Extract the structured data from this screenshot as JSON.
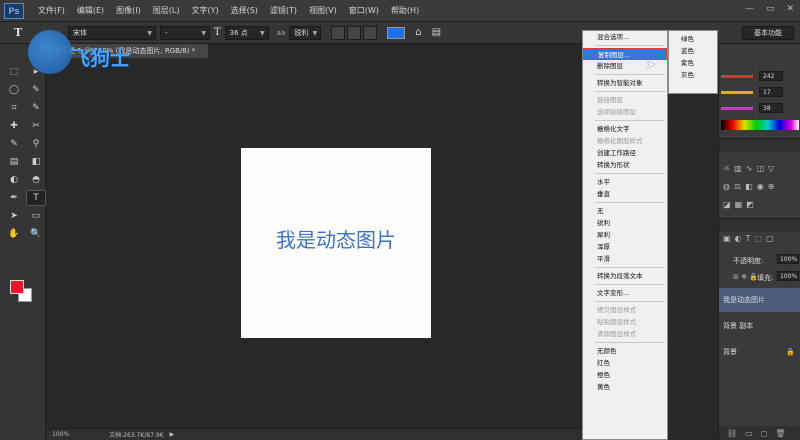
{
  "app": {
    "logo": "Ps"
  },
  "menu": [
    "文件(F)",
    "编辑(E)",
    "图像(I)",
    "图层(L)",
    "文字(Y)",
    "选择(S)",
    "滤镜(T)",
    "视图(V)",
    "窗口(W)",
    "帮助(H)"
  ],
  "window_controls": [
    "—",
    "▭",
    "✕"
  ],
  "options": {
    "tool_glyph": "T",
    "font_family": "宋体",
    "font_style": "-",
    "font_size": "36 点",
    "antialias": "锐利",
    "text_color": "#1e6fe8",
    "workspace": "基本功能"
  },
  "document": {
    "tab_title": "未标题-1 @ 100% (我是动态图片, RGB/8) *",
    "canvas_text": "我是动态图片",
    "zoom": "100%",
    "doc_info": "文档:263.7K/87.9K"
  },
  "watermark": {
    "text": "飞狗士"
  },
  "toolbar": {
    "tools": [
      "⬚",
      "▸",
      "◯",
      "✎",
      "⌗",
      "✎",
      "✚",
      "✂",
      "✎",
      "⚲",
      "▤",
      "◧",
      "◐",
      "◓",
      "✒",
      "T",
      "➤",
      "▭",
      "✋",
      "🔍"
    ],
    "foreground_color": "#e8192c",
    "background_color": "#ffffff"
  },
  "context_menu": {
    "groups": [
      [
        {
          "label": "混合选项...",
          "disabled": false
        }
      ],
      [
        {
          "label": "复制图层...",
          "disabled": false,
          "highlighted": true
        },
        {
          "label": "删除图层",
          "disabled": false
        }
      ],
      [
        {
          "label": "转换为智能对象",
          "disabled": false
        }
      ],
      [
        {
          "label": "链接图层",
          "disabled": true
        },
        {
          "label": "选择链接图层",
          "disabled": true
        }
      ],
      [
        {
          "label": "栅格化文字",
          "disabled": false
        },
        {
          "label": "栅格化图层样式",
          "disabled": true
        },
        {
          "label": "创建工作路径",
          "disabled": false
        },
        {
          "label": "转换为形状",
          "disabled": false
        }
      ],
      [
        {
          "label": "水平",
          "disabled": false
        },
        {
          "label": "垂直",
          "disabled": false
        }
      ],
      [
        {
          "label": "无",
          "disabled": false
        },
        {
          "label": "锐利",
          "disabled": false
        },
        {
          "label": "犀利",
          "disabled": false
        },
        {
          "label": "浑厚",
          "disabled": false
        },
        {
          "label": "平滑",
          "disabled": false
        }
      ],
      [
        {
          "label": "转换为段落文本",
          "disabled": false
        }
      ],
      [
        {
          "label": "文字变形...",
          "disabled": false
        }
      ],
      [
        {
          "label": "拷贝图层样式",
          "disabled": true
        },
        {
          "label": "粘贴图层样式",
          "disabled": true
        },
        {
          "label": "清除图层样式",
          "disabled": true
        }
      ],
      [
        {
          "label": "无颜色",
          "disabled": false
        },
        {
          "label": "红色",
          "disabled": false
        },
        {
          "label": "橙色",
          "disabled": false
        },
        {
          "label": "黄色",
          "disabled": false
        }
      ]
    ]
  },
  "color_submenu": [
    "绿色",
    "蓝色",
    "紫色",
    "灰色"
  ],
  "right_panel": {
    "color_values": [
      {
        "value": "242",
        "color": "#e0303a"
      },
      {
        "value": "17",
        "color": "#e0b020"
      },
      {
        "value": "38",
        "color": "#c040c0"
      }
    ],
    "opacity_label": "不透明度:",
    "opacity_value": "100%",
    "fill_label": "填充:",
    "fill_value": "100%",
    "layers": [
      {
        "name": "我是动态图片",
        "active": true
      },
      {
        "name": "背景 副本",
        "active": false
      },
      {
        "name": "背景",
        "active": false
      }
    ]
  }
}
